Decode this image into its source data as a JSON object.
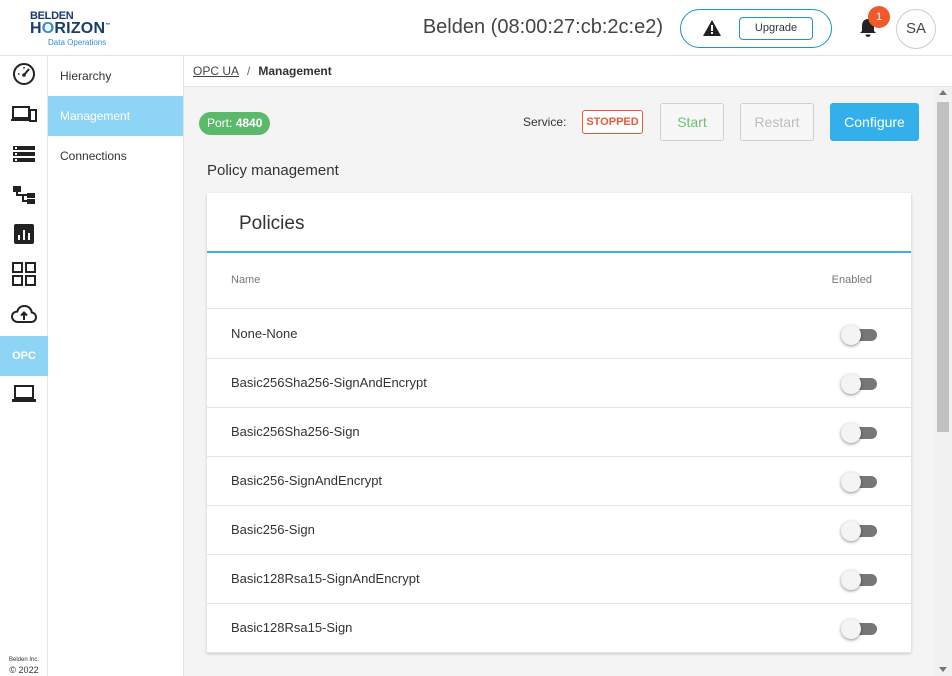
{
  "header": {
    "logo": {
      "line1": "BELDEN",
      "line2_a": "H",
      "line2_b": "RIZON",
      "tm": "™",
      "line3": "Data Operations"
    },
    "device_title": "Belden (08:00:27:cb:2c:e2)",
    "upgrade_label": "Upgrade",
    "notification_count": "1",
    "avatar_initials": "SA"
  },
  "rail": {
    "items": [
      {
        "icon": "dashboard-gauge-icon"
      },
      {
        "icon": "devices-icon"
      },
      {
        "icon": "list-icon"
      },
      {
        "icon": "hierarchy-icon"
      },
      {
        "icon": "analytics-icon"
      },
      {
        "icon": "apps-grid-icon"
      },
      {
        "icon": "cloud-upload-icon"
      },
      {
        "label": "OPC",
        "active": true
      },
      {
        "icon": "laptop-icon"
      }
    ],
    "footer_line1": "Belden Inc.",
    "footer_line2": "© 2022"
  },
  "subnav": {
    "items": [
      {
        "label": "Hierarchy",
        "active": false
      },
      {
        "label": "Management",
        "active": true
      },
      {
        "label": "Connections",
        "active": false
      }
    ]
  },
  "breadcrumb": {
    "parent": "OPC UA",
    "separator": "/",
    "current": "Management"
  },
  "toolbar": {
    "port_label": "Port:",
    "port_value": "4840",
    "service_label": "Service:",
    "service_status": "STOPPED",
    "start_label": "Start",
    "restart_label": "Restart",
    "configure_label": "Configure"
  },
  "section_title": "Policy management",
  "policies": {
    "title": "Policies",
    "col_name": "Name",
    "col_enabled": "Enabled",
    "rows": [
      {
        "name": "None-None",
        "enabled": false
      },
      {
        "name": "Basic256Sha256-SignAndEncrypt",
        "enabled": false
      },
      {
        "name": "Basic256Sha256-Sign",
        "enabled": false
      },
      {
        "name": "Basic256-SignAndEncrypt",
        "enabled": false
      },
      {
        "name": "Basic256-Sign",
        "enabled": false
      },
      {
        "name": "Basic128Rsa15-SignAndEncrypt",
        "enabled": false
      },
      {
        "name": "Basic128Rsa15-Sign",
        "enabled": false
      }
    ]
  },
  "colors": {
    "accent": "#33b0ea",
    "nav_active": "#8dd4f5",
    "port_badge": "#5cb86a",
    "stopped": "#e55a3c",
    "notification": "#ef5a2a"
  }
}
